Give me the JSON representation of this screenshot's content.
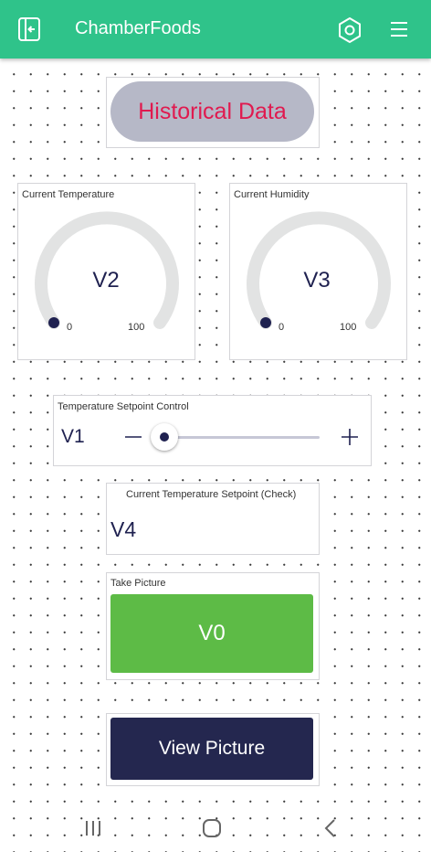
{
  "header": {
    "title": "ChamberFoods",
    "color": "#2fc38a",
    "icons": [
      "exit-icon",
      "settings-hexagon-icon",
      "menu-icon"
    ]
  },
  "historical": {
    "label": "Historical Data",
    "text_color": "#e01a4f",
    "bg_color": "#b6b8c7"
  },
  "temperature_gauge": {
    "label": "Current Temperature",
    "value": "V2",
    "min": "0",
    "max": "100",
    "level": 0
  },
  "humidity_gauge": {
    "label": "Current Humidity",
    "value": "V3",
    "min": "0",
    "max": "100",
    "level": 0
  },
  "setpoint_control": {
    "label": "Temperature Setpoint Control",
    "value": "V1",
    "minus": "—",
    "plus": "+",
    "level": 0.05
  },
  "setpoint_check": {
    "label": "Current Temperature Setpoint (Check)",
    "value": "V4"
  },
  "take_picture": {
    "label": "Take Picture",
    "button": "V0",
    "color": "#5dbb46"
  },
  "view_picture": {
    "button": "View Picture",
    "color": "#24274f"
  },
  "nav": {
    "icons": [
      "recent-apps-icon",
      "home-icon",
      "back-icon"
    ]
  }
}
